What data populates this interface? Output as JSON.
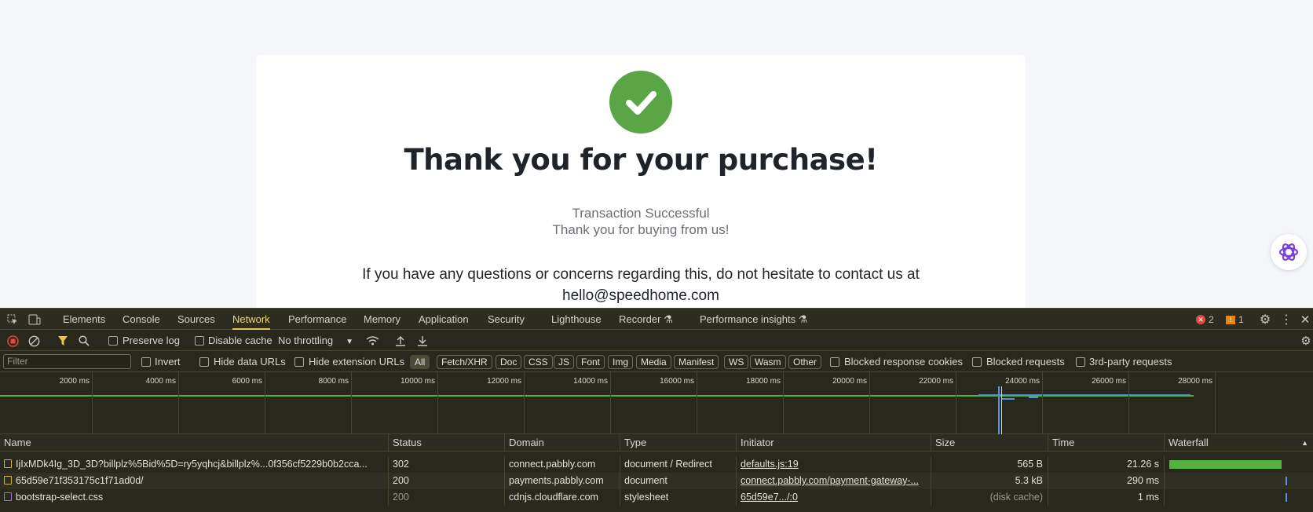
{
  "page": {
    "title": "Thank you for your purchase!",
    "status_line": "Transaction Successful",
    "thanks_line": "Thank you for buying from us!",
    "contact_line1": "If you have any questions or concerns regarding this, do not hesitate to contact us at",
    "contact_email": "hello@speedhome.com"
  },
  "devtools": {
    "tabs": [
      "Elements",
      "Console",
      "Sources",
      "Network",
      "Performance",
      "Memory",
      "Application",
      "Security",
      "Lighthouse",
      "Recorder",
      "Performance insights"
    ],
    "active_tab": "Network",
    "error_count": "2",
    "warning_count": "1",
    "toolbar": {
      "preserve_log": "Preserve log",
      "disable_cache": "Disable cache",
      "throttling": "No throttling"
    },
    "filter": {
      "placeholder": "Filter",
      "invert": "Invert",
      "hide_data_urls": "Hide data URLs",
      "hide_extension_urls": "Hide extension URLs",
      "types": [
        "All",
        "Fetch/XHR",
        "Doc",
        "CSS",
        "JS",
        "Font",
        "Img",
        "Media",
        "Manifest",
        "WS",
        "Wasm",
        "Other"
      ],
      "blocked_response_cookies": "Blocked response cookies",
      "blocked_requests": "Blocked requests",
      "third_party": "3rd-party requests"
    },
    "timeline_ticks": [
      "2000 ms",
      "4000 ms",
      "6000 ms",
      "8000 ms",
      "10000 ms",
      "12000 ms",
      "14000 ms",
      "16000 ms",
      "18000 ms",
      "20000 ms",
      "22000 ms",
      "24000 ms",
      "26000 ms",
      "28000 ms"
    ],
    "columns": [
      "Name",
      "Status",
      "Domain",
      "Type",
      "Initiator",
      "Size",
      "Time",
      "Waterfall"
    ],
    "rows": [
      {
        "name": "IjIxMDk4Ig_3D_3D?billplz%5Bid%5D=ry5yqhcj&billplz%...0f356cf5229b0b2cca...",
        "status": "302",
        "domain": "connect.pabbly.com",
        "type": "document / Redirect",
        "initiator": "defaults.js:19",
        "size": "565 B",
        "time": "21.26 s",
        "waterfall_fraction": 0.95
      },
      {
        "name": "65d59e71f353175c1f71ad0d/",
        "status": "200",
        "domain": "payments.pabbly.com",
        "type": "document",
        "initiator": "connect.pabbly.com/payment-gateway-...",
        "size": "5.3 kB",
        "time": "290 ms",
        "waterfall_fraction": 0.01
      },
      {
        "name": "bootstrap-select.css",
        "status": "200",
        "domain": "cdnjs.cloudflare.com",
        "type": "stylesheet",
        "initiator": "65d59e7.../:0",
        "size": "(disk cache)",
        "time": "1 ms",
        "waterfall_fraction": 0.005
      }
    ]
  }
}
